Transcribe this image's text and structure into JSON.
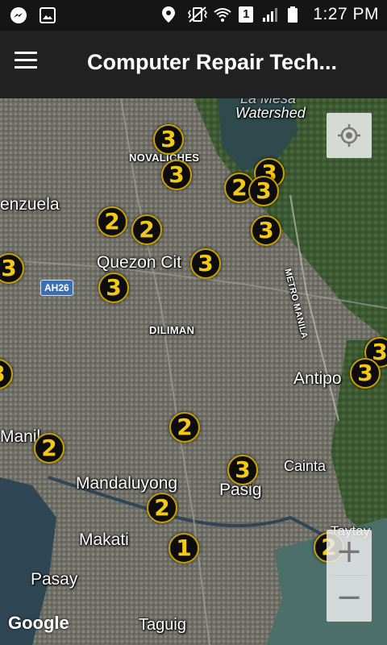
{
  "status_bar": {
    "time": "1:27 PM",
    "sim_slot": "1",
    "left_icons": [
      "messenger-icon",
      "image-icon"
    ],
    "right_icons": [
      "location-icon",
      "vibrate-icon",
      "wifi-icon",
      "sim-icon",
      "signal-icon",
      "battery-icon"
    ]
  },
  "app_bar": {
    "title": "Computer Repair Tech..."
  },
  "map": {
    "place_labels": {
      "watershed_top": "La Mesa",
      "watershed": "Watershed",
      "novaliches": "NOVALICHES",
      "valenzuela": "enzuela",
      "quezon_city": "Quezon Cit",
      "metro_manila": "METRO MANILA",
      "diliman": "DILIMAN",
      "antipolo": "Antipo",
      "manila": "Manil",
      "cainta": "Cainta",
      "mandaluyong": "Mandaluyong",
      "pasig": "Pasig",
      "taytay": "Taytay",
      "makati": "Makati",
      "pasay": "Pasay",
      "taguig": "Taguig"
    },
    "road_shield": "AH26",
    "markers": [
      "3",
      "3",
      "3",
      "2",
      "3",
      "2",
      "2",
      "3",
      "3",
      "3",
      "3",
      "3",
      "3",
      "3",
      "2",
      "2",
      "3",
      "2",
      "1",
      "2",
      "3",
      "3"
    ],
    "attribution": "Google"
  },
  "controls": {
    "zoom_in": "+",
    "zoom_out": "−"
  }
}
